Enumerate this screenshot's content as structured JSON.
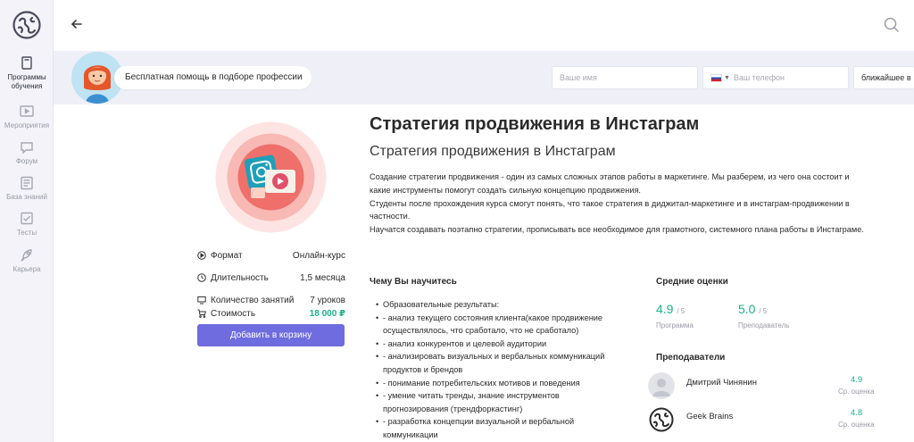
{
  "sidebar": {
    "items": [
      {
        "label": "Программы обучения",
        "active": true
      },
      {
        "label": "Мероприятия"
      },
      {
        "label": "Форум"
      },
      {
        "label": "База знаний"
      },
      {
        "label": "Тесты"
      },
      {
        "label": "Карьера"
      }
    ]
  },
  "promo": {
    "help_text": "Бесплатная помощь в подборе профессии",
    "name_placeholder": "Ваше имя",
    "phone_placeholder": "Ваш телефон",
    "time_select": "ближайшее в"
  },
  "course": {
    "title": "Стратегия продвижения в Инстаграм",
    "subtitle": "Стратегия продвижения в Инстаграм",
    "description": [
      "Создание стратегии продвижения - один из самых сложных этапов работы в маркетинге. Мы разберем, из чего она состоит и какие инструменты помогут создать сильную концепцию продвижения.",
      "Студенты после прохождения курса смогут понять, что такое стратегия в диджитал-маркетинге и в инстаграм-продвижении в частности.",
      "Научатся создавать поэтапно стратегии, прописывать все необходимое для грамотного, системного плана работы в Инстаграме."
    ]
  },
  "info": {
    "format_label": "Формат",
    "format_value": "Онлайн-курс",
    "duration_label": "Длительность",
    "duration_value": "1,5 месяца",
    "lessons_label": "Количество занятий",
    "lessons_value": "7 уроков",
    "price_label": "Стоимость",
    "price_value": "18 000 ₽",
    "cart_button": "Добавить в корзину"
  },
  "learn": {
    "heading": "Чему Вы научитесь",
    "items": [
      "Образовательные результаты:",
      "- анализ текущего состояния клиента(какое продвижение осуществлялось, что сработало, что не сработало)",
      "- анализ конкурентов и целевой аудитории",
      "- анализировать визуальных и вербальных коммуникаций продуктов и брендов",
      "- понимание потребительских мотивов и поведения",
      "- умение читать тренды, знание инструментов прогнозирования (трендфоркастинг)",
      "- разработка концепции визуальной и вербальной коммуникации"
    ]
  },
  "ratings": {
    "heading": "Средние оценки",
    "program_score": "4.9",
    "program_of": "/ 5",
    "program_caption": "Программа",
    "teachers_score": "5.0",
    "teachers_of": "/ 5",
    "teachers_caption": "Преподаватель"
  },
  "teachers": {
    "heading": "Преподаватели",
    "list": [
      {
        "name": "Дмитрий Чинянин",
        "score": "4.9",
        "caption": "Ср. оценка"
      },
      {
        "name": "Geek Brains",
        "score": "4.8",
        "caption": "Ср. оценка"
      }
    ]
  },
  "colors": {
    "accent": "#6f6cdf",
    "green": "#1bb18b",
    "sidebar_bg": "#f3f3f9",
    "band_bg": "#eff0f7"
  }
}
